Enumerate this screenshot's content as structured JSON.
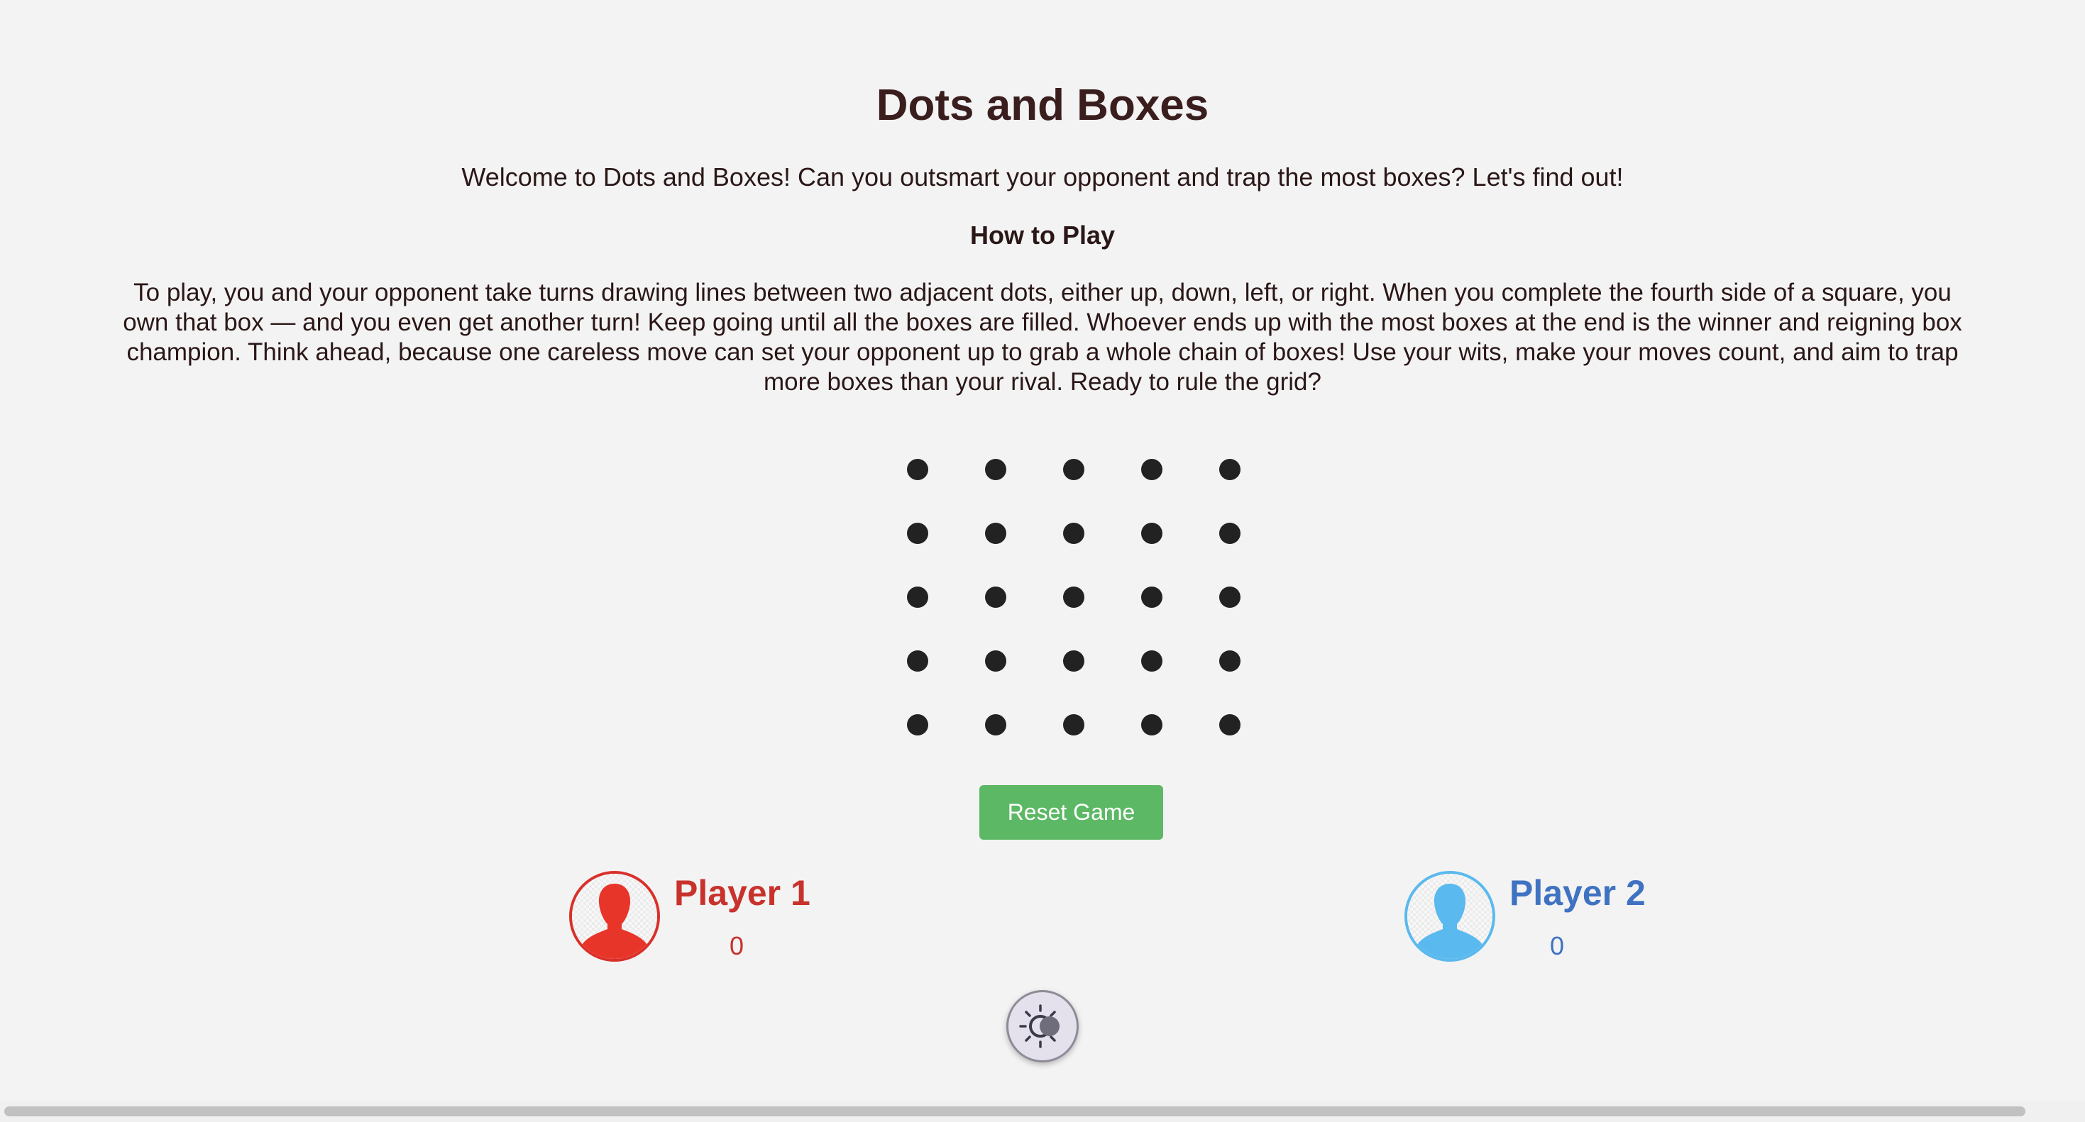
{
  "header": {
    "title": "Dots and Boxes",
    "welcome": "Welcome to Dots and Boxes! Can you outsmart your opponent and trap the most boxes? Let's find out!",
    "howto_heading": "How to Play",
    "rules": "To play, you and your opponent take turns drawing lines between two adjacent dots, either up, down, left, or right. When you complete the fourth side of a square, you own that box — and you even get another turn! Keep going until all the boxes are filled. Whoever ends up with the most boxes at the end is the winner and reigning box champion. Think ahead, because one careless move can set your opponent up to grab a whole chain of boxes! Use your wits, make your moves count, and aim to trap more boxes than your rival. Ready to rule the grid?"
  },
  "board": {
    "rows": 5,
    "cols": 5,
    "dot_color": "#222222"
  },
  "controls": {
    "reset_label": "Reset Game",
    "reset_color": "#5cb865"
  },
  "players": [
    {
      "name": "Player 1",
      "score": "0",
      "color": "#c8322c",
      "avatar_color": "#e8352a",
      "icon": "user-avatar-icon"
    },
    {
      "name": "Player 2",
      "score": "0",
      "color": "#3f72c2",
      "avatar_color": "#5ab9ee",
      "icon": "user-avatar-icon"
    }
  ],
  "theme_toggle": {
    "icon": "theme-toggle-icon"
  }
}
